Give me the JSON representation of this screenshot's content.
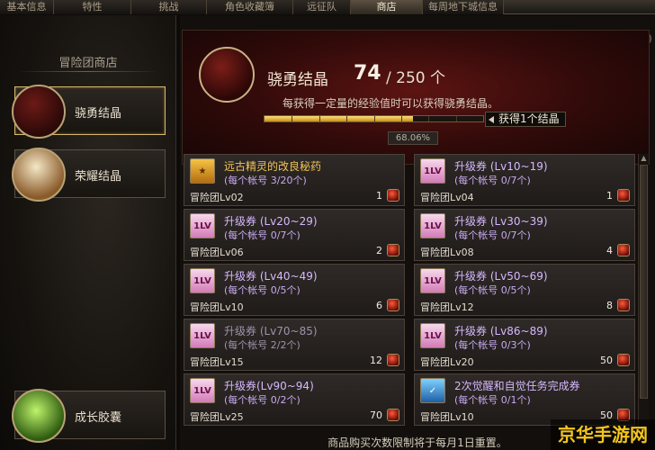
{
  "tabs": [
    "基本信息",
    "特性",
    "挑战",
    "角色收藏簿",
    "远征队",
    "商店",
    "每周地下城信息"
  ],
  "active_tab": "商店",
  "left": {
    "title": "冒险团商店",
    "categories": [
      {
        "label": "骁勇结晶",
        "active": true,
        "icon": "brave-crystal-icon"
      },
      {
        "label": "荣耀结晶",
        "active": false,
        "icon": "glory-trophy-icon"
      },
      {
        "label": "成长胶囊",
        "active": false,
        "icon": "exp-capsule-icon"
      }
    ]
  },
  "header": {
    "name": "骁勇结晶",
    "count": "74",
    "max": "/ 250 个",
    "desc": "每获得一定量的经验值时可以获得骁勇结晶。",
    "progress_fraction": 0.6806,
    "progress_pct": "68.06%",
    "tip": "获得1个结晶"
  },
  "items": [
    {
      "name": "远古精灵的改良秘药",
      "limit": "(每个帐号 3/20个)",
      "req": "冒险团Lv02",
      "price": "1",
      "icon": "potion",
      "style": "gold"
    },
    {
      "name": "升级券 (Lv10~19)",
      "limit": "(每个帐号 0/7个)",
      "req": "冒险团Lv04",
      "price": "1",
      "icon": "ticket",
      "style": ""
    },
    {
      "name": "升级券 (Lv20~29)",
      "limit": "(每个帐号 0/7个)",
      "req": "冒险团Lv06",
      "price": "2",
      "icon": "ticket",
      "style": ""
    },
    {
      "name": "升级券 (Lv30~39)",
      "limit": "(每个帐号 0/7个)",
      "req": "冒险团Lv08",
      "price": "4",
      "icon": "ticket",
      "style": ""
    },
    {
      "name": "升级券 (Lv40~49)",
      "limit": "(每个帐号 0/5个)",
      "req": "冒险团Lv10",
      "price": "6",
      "icon": "ticket",
      "style": ""
    },
    {
      "name": "升级券 (Lv50~69)",
      "limit": "(每个帐号 0/5个)",
      "req": "冒险团Lv12",
      "price": "8",
      "icon": "ticket",
      "style": ""
    },
    {
      "name": "升级券 (Lv70~85)",
      "limit": "(每个帐号 2/2个)",
      "req": "冒险团Lv15",
      "price": "12",
      "icon": "ticket",
      "style": "dim"
    },
    {
      "name": "升级券 (Lv86~89)",
      "limit": "(每个帐号 0/3个)",
      "req": "冒险团Lv20",
      "price": "50",
      "icon": "ticket",
      "style": ""
    },
    {
      "name": "升级券(Lv90~94)",
      "limit": "(每个帐号 0/2个)",
      "req": "冒险团Lv25",
      "price": "70",
      "icon": "ticket",
      "style": ""
    },
    {
      "name": "2次觉醒和自觉任务完成券",
      "limit": "(每个帐号 0/1个)",
      "req": "冒险团Lv10",
      "price": "50",
      "icon": "quest",
      "style": ""
    }
  ],
  "footer": "商品购买次数限制将于每月1日重置。",
  "help": "?",
  "watermark": "京华手游网"
}
